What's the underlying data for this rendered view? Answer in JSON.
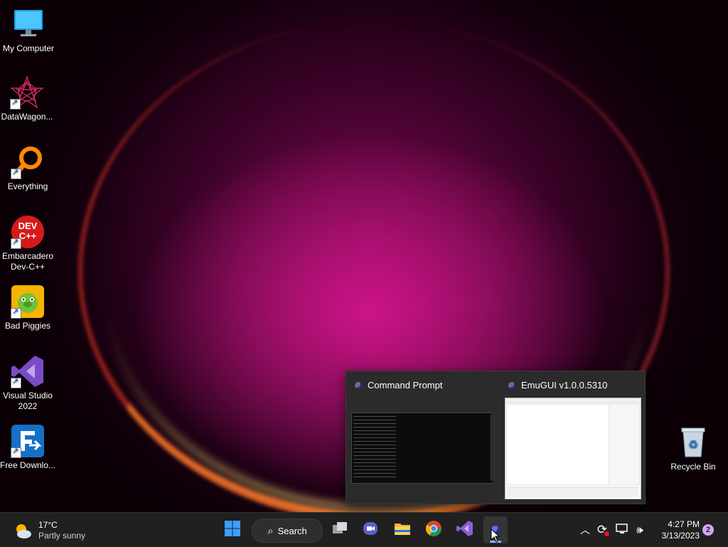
{
  "desktop": {
    "icons": [
      {
        "label": "My Computer",
        "icon": "monitor-icon"
      },
      {
        "label": "DataWagon...",
        "icon": "datawagon-icon"
      },
      {
        "label": "Everything",
        "icon": "magnifier-icon"
      },
      {
        "label": "Embarcadero Dev-C++",
        "icon": "devcpp-icon",
        "badge": "DEV C++"
      },
      {
        "label": "Bad Piggies",
        "icon": "bad-piggies-icon"
      },
      {
        "label": "Visual Studio 2022",
        "icon": "visual-studio-icon"
      },
      {
        "label": "Free Downlo...",
        "icon": "free-download-icon"
      }
    ],
    "recycle_bin": {
      "label": "Recycle Bin",
      "icon": "recycle-bin-icon"
    }
  },
  "flyout": {
    "windows": [
      {
        "title": "Command Prompt",
        "icon": "emugui-icon"
      },
      {
        "title": "EmuGUI v1.0.0.5310",
        "icon": "emugui-icon"
      }
    ]
  },
  "taskbar": {
    "weather": {
      "temp": "17°C",
      "condition": "Partly sunny",
      "icon": "partly-sunny-icon"
    },
    "search_label": "Search",
    "apps": [
      "windows-start-icon",
      "task-view-icon",
      "teams-chat-icon",
      "file-explorer-icon",
      "chrome-icon",
      "visual-studio-icon",
      "emugui-icon"
    ],
    "tray": {
      "time": "4:27 PM",
      "date": "3/13/2023",
      "notifications": "2"
    }
  },
  "colors": {
    "taskbar": "#202020",
    "flyout": "#2b2b2b",
    "accent": "#e0007a"
  }
}
